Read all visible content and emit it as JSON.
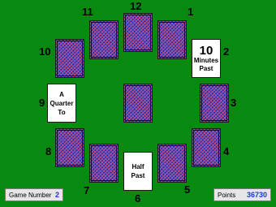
{
  "clock_numbers": [
    "12",
    "1",
    "2",
    "3",
    "4",
    "5",
    "6",
    "7",
    "8",
    "9",
    "10",
    "11"
  ],
  "face_up": {
    "minutes_past": {
      "big": "10",
      "line1": "Minutes",
      "line2": "Past"
    },
    "quarter_to": {
      "line1": "A",
      "line2": "Quarter",
      "line3": "To"
    },
    "half_past": {
      "line1": "Half",
      "line2": "Past"
    }
  },
  "status": {
    "game_number_label": "Game Number",
    "game_number_value": "2",
    "points_label": "Points",
    "points_value": "36730"
  },
  "colors": {
    "table_green": "#078a0f",
    "card_back": "#2a2fa8",
    "points_value": "#1a37d6"
  }
}
